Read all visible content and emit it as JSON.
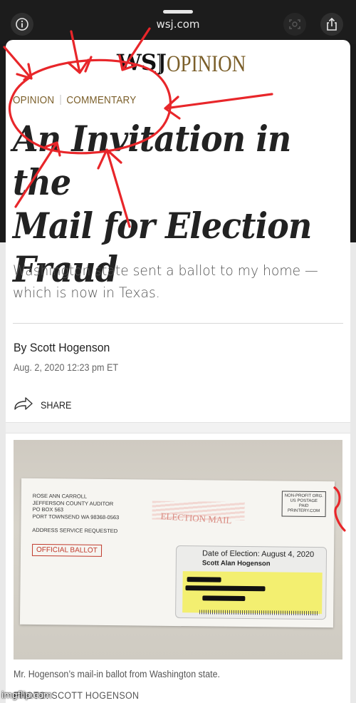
{
  "browser": {
    "url": "wsj.com"
  },
  "masthead": {
    "logo": "WSJ",
    "section": "OPINION"
  },
  "article": {
    "kicker_section": "OPINION",
    "kicker_type": "COMMENTARY",
    "headline": "An Invitation in the\nMail for Election\nFraud",
    "dek": "Washington state sent a ballot to my home —which is now in Texas.",
    "byline_prefix": "By ",
    "author": "Scott Hogenson",
    "date": "Aug. 2, 2020 12:23 pm ET",
    "share_label": "SHARE"
  },
  "photo": {
    "return_address": "ROSE ANN CARROLL\nJEFFERSON COUNTY AUDITOR\nPO BOX 563\nPORT TOWNSEND WA 98368-0563",
    "address_service": "ADDRESS SERVICE REQUESTED",
    "official_ballot": "OFFICIAL BALLOT",
    "postage": "NON-PROFIT ORG.\nUS POSTAGE\nPAID\nPRINTERY.COM",
    "election_mail": "ELECTION MAIL",
    "date_of_election": "Date of Election: August 4, 2020",
    "voter_name": "Scott Alan Hogenson",
    "caption": "Mr. Hogenson’s mail-in ballot from Washington state.",
    "credit": "PHOTO: SCOTT HOGENSON"
  },
  "watermark": "imgflip.com",
  "colors": {
    "opinion_gold": "#7b5f2a",
    "annotation_red": "#e8262a"
  }
}
